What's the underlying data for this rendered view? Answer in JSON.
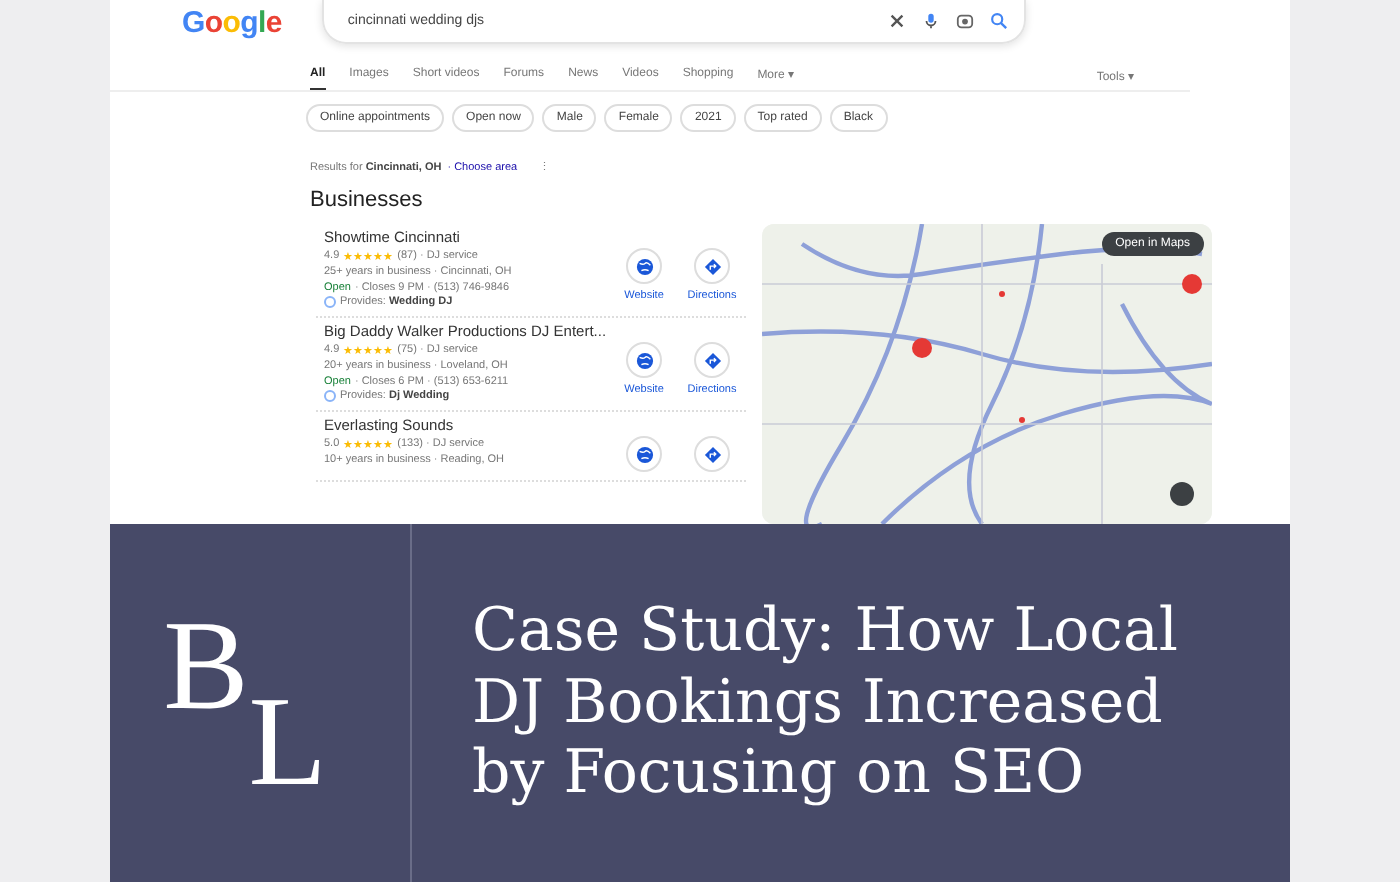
{
  "search_page": {
    "logo": "Google",
    "query": "cincinnati wedding djs",
    "tabs": [
      {
        "label": "All",
        "selected": true
      },
      {
        "label": "Images",
        "selected": false
      },
      {
        "label": "Short videos",
        "selected": false
      },
      {
        "label": "Forums",
        "selected": false
      },
      {
        "label": "News",
        "selected": false
      },
      {
        "label": "Videos",
        "selected": false
      },
      {
        "label": "Shopping",
        "selected": false
      },
      {
        "label": "More ▾",
        "selected": false
      }
    ],
    "tools": "Tools ▾",
    "chips": [
      "Online appointments",
      "Open now",
      "Male",
      "Female",
      "2021",
      "Top rated",
      "Black"
    ],
    "results_for": {
      "prefix": "Results for ",
      "place": "Cincinnati, OH",
      "link": "· Choose area",
      "menu": "⋮"
    },
    "heading": "Businesses",
    "businesses": [
      {
        "name": "Showtime Cincinnati",
        "rating": "4.9",
        "stars": 5,
        "reviews": "(87) · DJ service",
        "details": "25+ years in business · Cincinnati, OH",
        "open": "Open",
        "hours": "· Closes 9 PM · (513) 746-9846",
        "provides_label": "Provides:",
        "provides": "Wedding DJ",
        "actions": [
          "Website",
          "Directions"
        ]
      },
      {
        "name": "Big Daddy Walker Productions DJ Entert...",
        "rating": "4.9",
        "stars": 5,
        "reviews": "(75) · DJ service",
        "details": "20+ years in business · Loveland, OH",
        "open": "Open",
        "hours": "· Closes 6 PM · (513) 653-6211",
        "provides_label": "Provides:",
        "provides": "Dj Wedding",
        "actions": [
          "Website",
          "Directions"
        ]
      },
      {
        "name": "Everlasting Sounds",
        "rating": "5.0",
        "stars": 5,
        "reviews": "(133) · DJ service",
        "details": "10+ years in business · Reading, OH"
      }
    ],
    "map": {
      "button": "Open in Maps"
    }
  },
  "banner": {
    "logo": "BL",
    "title": "Case Study: How Local DJ Bookings Increased by Focusing on SEO"
  }
}
